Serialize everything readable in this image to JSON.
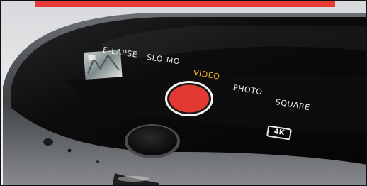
{
  "camera": {
    "modes": {
      "timelapse": "E-LAPSE",
      "slomo": "SLO-MO",
      "video": "VIDEO",
      "photo": "PHOTO",
      "square": "SQUARE"
    },
    "active_mode": "VIDEO",
    "resolution_badge": "4K",
    "shutter_color": "#e03a33",
    "active_mode_color": "#f4b728"
  },
  "banner": {
    "color": "#e53a36"
  }
}
